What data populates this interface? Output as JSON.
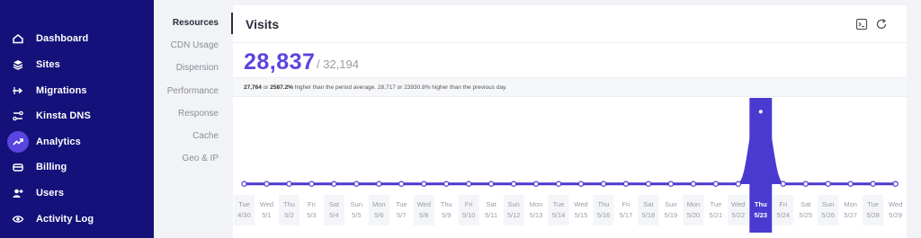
{
  "sidebar": {
    "items": [
      {
        "label": "Dashboard",
        "icon": "home-icon",
        "name": "sidebar-item-dashboard",
        "top": 28
      },
      {
        "label": "Sites",
        "icon": "layers-icon",
        "name": "sidebar-item-sites",
        "top": 57
      },
      {
        "label": "Migrations",
        "icon": "migrate-icon",
        "name": "sidebar-item-migrations",
        "top": 86
      },
      {
        "label": "Kinsta DNS",
        "icon": "dns-icon",
        "name": "sidebar-item-kinsta-dns",
        "top": 114
      },
      {
        "label": "Analytics",
        "icon": "trend-icon",
        "name": "sidebar-item-analytics",
        "top": 143,
        "active": true
      },
      {
        "label": "Billing",
        "icon": "billing-icon",
        "name": "sidebar-item-billing",
        "top": 171
      },
      {
        "label": "Users",
        "icon": "add-user-icon",
        "name": "sidebar-item-users",
        "top": 200
      },
      {
        "label": "Activity Log",
        "icon": "eye-icon",
        "name": "sidebar-item-activity-log",
        "top": 229
      }
    ]
  },
  "subnav": {
    "items": [
      {
        "label": "Resources",
        "active": true
      },
      {
        "label": "CDN Usage"
      },
      {
        "label": "Dispersion"
      },
      {
        "label": "Performance"
      },
      {
        "label": "Response"
      },
      {
        "label": "Cache"
      },
      {
        "label": "Geo & IP"
      }
    ]
  },
  "card": {
    "title": "Visits",
    "value": "28,837",
    "total": "/ 32,194",
    "summary_a": "27,764",
    "summary_b": " or ",
    "summary_c": "2587.2%",
    "summary_d": " higher than the period average. 28,717 or 23930.8% higher than the previous day."
  },
  "colors": {
    "sidebar": "#14117a",
    "accent": "#5a45e0",
    "line": "#4a3ad0"
  },
  "chart_data": {
    "type": "line",
    "categories": [
      [
        "Tue",
        "4/30"
      ],
      [
        "Wed",
        "5/1"
      ],
      [
        "Thu",
        "5/2"
      ],
      [
        "Fri",
        "5/3"
      ],
      [
        "Sat",
        "5/4"
      ],
      [
        "Sun",
        "5/5"
      ],
      [
        "Mon",
        "5/6"
      ],
      [
        "Tue",
        "5/7"
      ],
      [
        "Wed",
        "5/8"
      ],
      [
        "Thu",
        "5/9"
      ],
      [
        "Fri",
        "5/10"
      ],
      [
        "Sat",
        "5/11"
      ],
      [
        "Sun",
        "5/12"
      ],
      [
        "Mon",
        "5/13"
      ],
      [
        "Tue",
        "5/14"
      ],
      [
        "Wed",
        "5/15"
      ],
      [
        "Thu",
        "5/16"
      ],
      [
        "Fri",
        "5/17"
      ],
      [
        "Sat",
        "5/18"
      ],
      [
        "Sun",
        "5/19"
      ],
      [
        "Mon",
        "5/20"
      ],
      [
        "Tue",
        "5/21"
      ],
      [
        "Wed",
        "5/22"
      ],
      [
        "Thu",
        "5/23"
      ],
      [
        "Fri",
        "5/24"
      ],
      [
        "Sat",
        "5/25"
      ],
      [
        "Sun",
        "5/26"
      ],
      [
        "Mon",
        "5/27"
      ],
      [
        "Tue",
        "5/28"
      ],
      [
        "Wed",
        "5/29"
      ]
    ],
    "values": [
      110,
      110,
      110,
      110,
      110,
      110,
      110,
      110,
      110,
      110,
      110,
      110,
      110,
      110,
      110,
      110,
      110,
      110,
      110,
      110,
      110,
      110,
      110,
      28837,
      110,
      110,
      110,
      110,
      110,
      110
    ],
    "highlight_index": 23,
    "ylim": [
      0,
      32194
    ]
  }
}
